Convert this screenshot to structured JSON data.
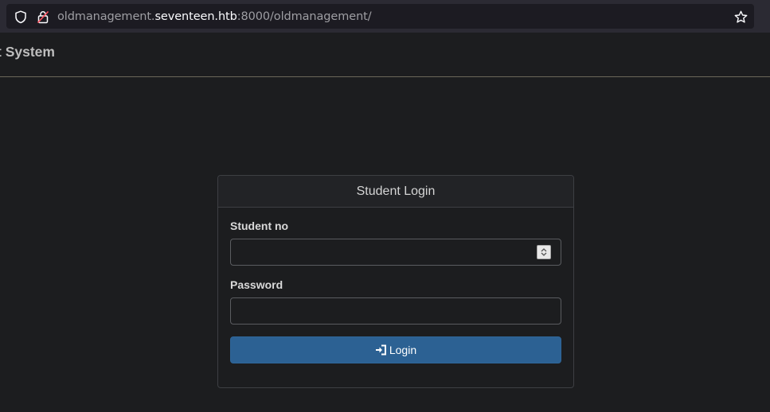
{
  "browser": {
    "url_prefix": "oldmanagement.",
    "url_domain": "seventeen.htb",
    "url_suffix": ":8000/oldmanagement/",
    "icons": [
      "shield-icon",
      "lock-warning-icon",
      "star-icon"
    ]
  },
  "header": {
    "title": "t System"
  },
  "login": {
    "card_title": "Student Login",
    "student_label": "Student no",
    "student_value": "",
    "password_label": "Password",
    "password_value": "",
    "button_label": "Login",
    "button_icon": "sign-in-icon",
    "accent_color": "#2c6193"
  }
}
